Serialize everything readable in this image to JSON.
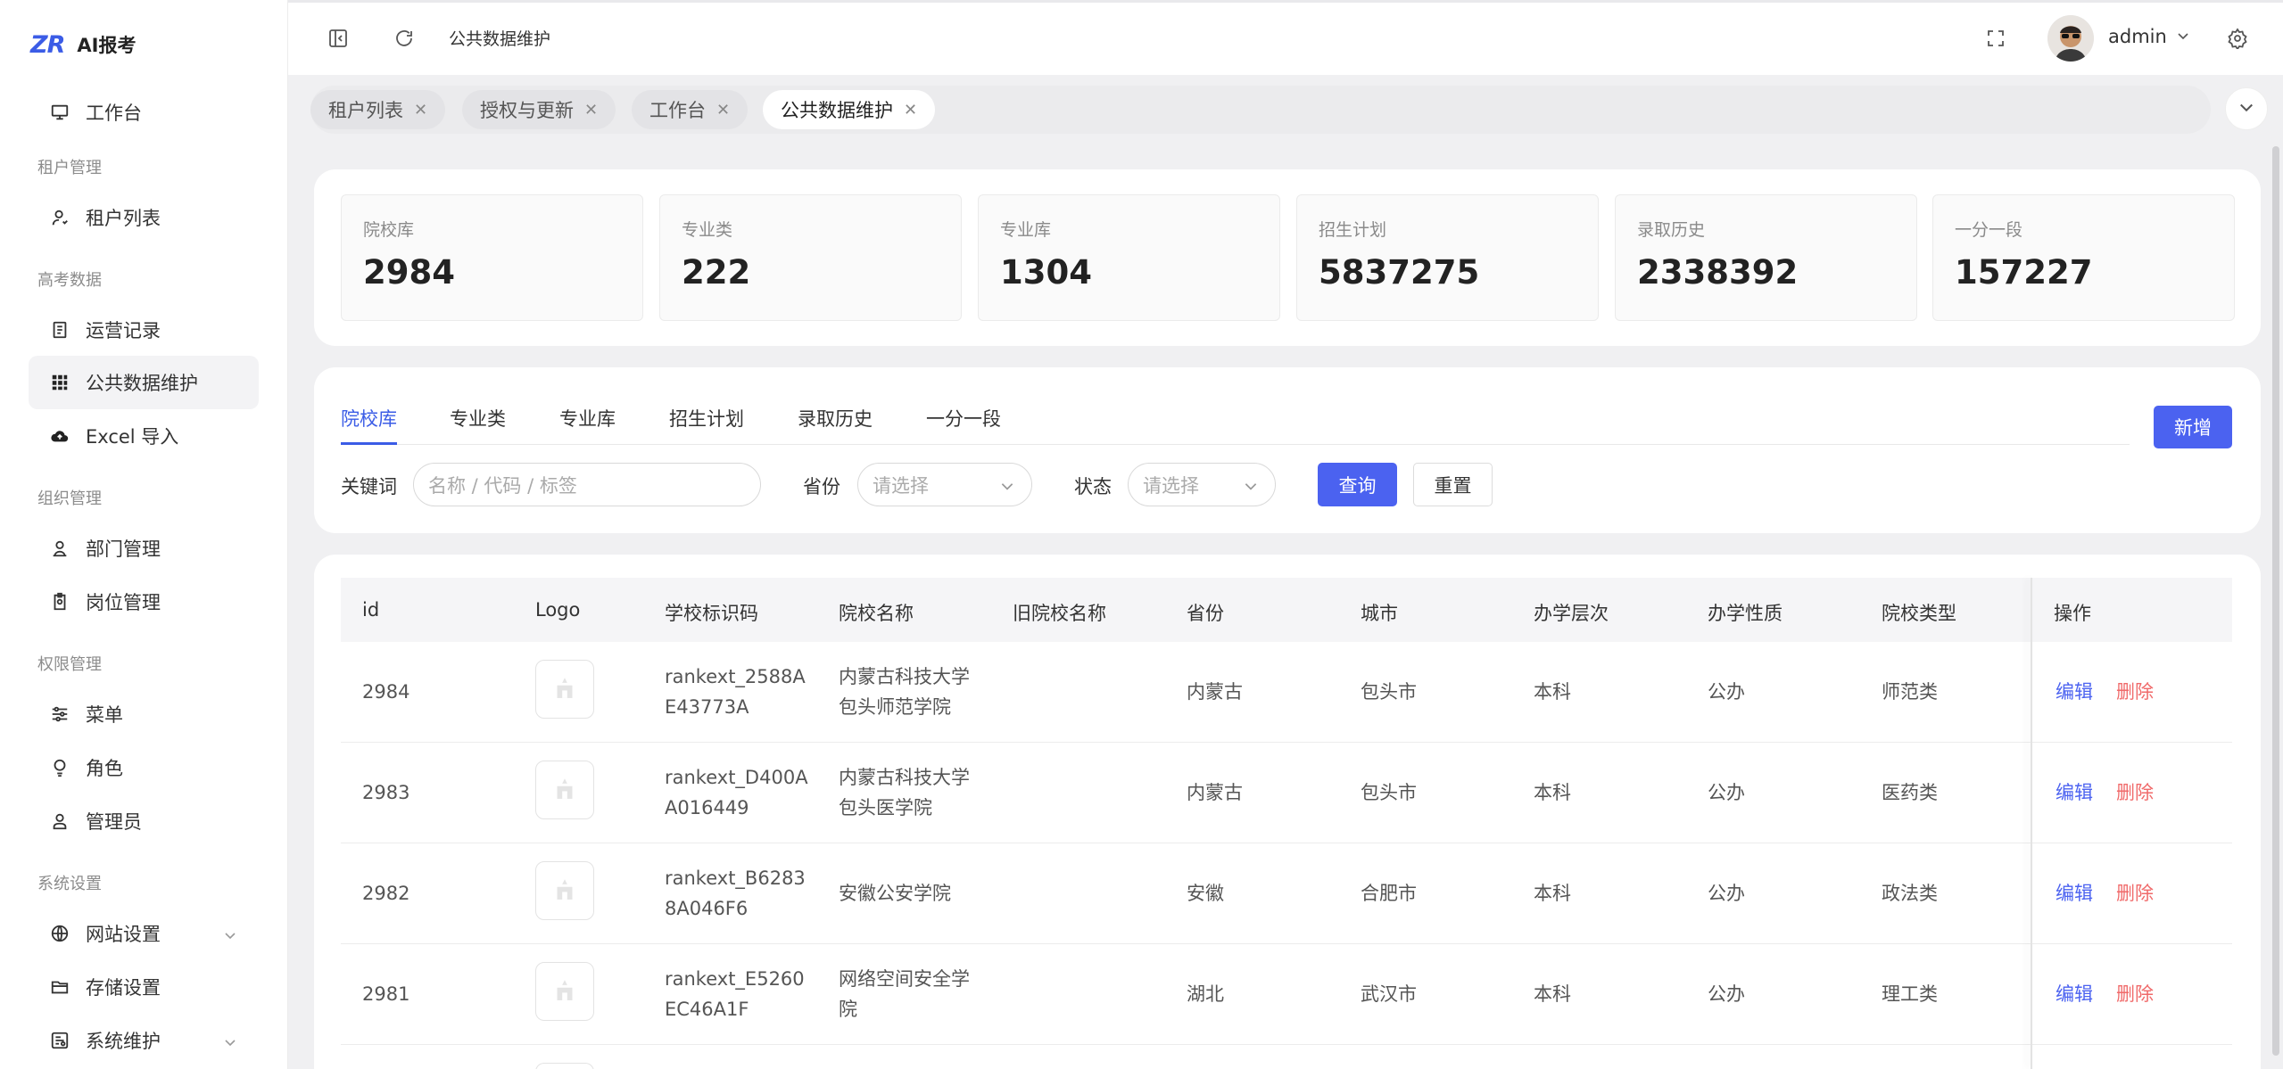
{
  "brand": {
    "logo": "ZR",
    "name": "AI报考"
  },
  "sidebar": {
    "items": [
      {
        "type": "item",
        "label": "工作台",
        "icon": "monitor-icon"
      },
      {
        "type": "group",
        "label": "租户管理"
      },
      {
        "type": "item",
        "label": "租户列表",
        "icon": "user-icon"
      },
      {
        "type": "group",
        "label": "高考数据"
      },
      {
        "type": "item",
        "label": "运营记录",
        "icon": "document-icon"
      },
      {
        "type": "item",
        "label": "公共数据维护",
        "icon": "grid-icon",
        "active": true
      },
      {
        "type": "item",
        "label": "Excel 导入",
        "icon": "cloud-upload-icon"
      },
      {
        "type": "group",
        "label": "组织管理"
      },
      {
        "type": "item",
        "label": "部门管理",
        "icon": "person-icon"
      },
      {
        "type": "item",
        "label": "岗位管理",
        "icon": "badge-icon"
      },
      {
        "type": "group",
        "label": "权限管理"
      },
      {
        "type": "item",
        "label": "菜单",
        "icon": "sliders-icon"
      },
      {
        "type": "item",
        "label": "角色",
        "icon": "bulb-icon"
      },
      {
        "type": "item",
        "label": "管理员",
        "icon": "admin-icon"
      },
      {
        "type": "group",
        "label": "系统设置"
      },
      {
        "type": "item",
        "label": "网站设置",
        "icon": "globe-icon",
        "expandable": true
      },
      {
        "type": "item",
        "label": "存储设置",
        "icon": "folder-icon"
      },
      {
        "type": "item",
        "label": "系统维护",
        "icon": "tools-icon",
        "expandable": true
      }
    ]
  },
  "topbar": {
    "title": "公共数据维护",
    "user": "admin"
  },
  "tabs": [
    {
      "label": "租户列表"
    },
    {
      "label": "授权与更新"
    },
    {
      "label": "工作台"
    },
    {
      "label": "公共数据维护",
      "active": true
    }
  ],
  "stats": [
    {
      "label": "院校库",
      "value": "2984"
    },
    {
      "label": "专业类",
      "value": "222"
    },
    {
      "label": "专业库",
      "value": "1304"
    },
    {
      "label": "招生计划",
      "value": "5837275"
    },
    {
      "label": "录取历史",
      "value": "2338392"
    },
    {
      "label": "一分一段",
      "value": "157227"
    }
  ],
  "subtabs": [
    "院校库",
    "专业类",
    "专业库",
    "招生计划",
    "录取历史",
    "一分一段"
  ],
  "add_button": "新增",
  "filters": {
    "keyword_label": "关键词",
    "keyword_placeholder": "名称 / 代码 / 标签",
    "province_label": "省份",
    "province_placeholder": "请选择",
    "status_label": "状态",
    "status_placeholder": "请选择",
    "query_button": "查询",
    "reset_button": "重置"
  },
  "table": {
    "columns": [
      "id",
      "Logo",
      "学校标识码",
      "院校名称",
      "旧院校名称",
      "省份",
      "城市",
      "办学层次",
      "办学性质",
      "院校类型",
      "操作"
    ],
    "edit_label": "编辑",
    "delete_label": "删除",
    "rows": [
      {
        "id": "2984",
        "code": [
          "rankext_2588A",
          "E43773A"
        ],
        "name": [
          "内蒙古科技大学",
          "包头师范学院"
        ],
        "old_name": "",
        "province": "内蒙古",
        "city": "包头市",
        "level": "本科",
        "nature": "公办",
        "type": "师范类"
      },
      {
        "id": "2983",
        "code": [
          "rankext_D400A",
          "A016449"
        ],
        "name": [
          "内蒙古科技大学",
          "包头医学院"
        ],
        "old_name": "",
        "province": "内蒙古",
        "city": "包头市",
        "level": "本科",
        "nature": "公办",
        "type": "医药类"
      },
      {
        "id": "2982",
        "code": [
          "rankext_B6283",
          "8A046F6"
        ],
        "name": [
          "安徽公安学院"
        ],
        "old_name": "",
        "province": "安徽",
        "city": "合肥市",
        "level": "本科",
        "nature": "公办",
        "type": "政法类"
      },
      {
        "id": "2981",
        "code": [
          "rankext_E5260",
          "EC46A1F"
        ],
        "name": [
          "网络空间安全学",
          "院"
        ],
        "old_name": "",
        "province": "湖北",
        "city": "武汉市",
        "level": "本科",
        "nature": "公办",
        "type": "理工类"
      }
    ]
  }
}
